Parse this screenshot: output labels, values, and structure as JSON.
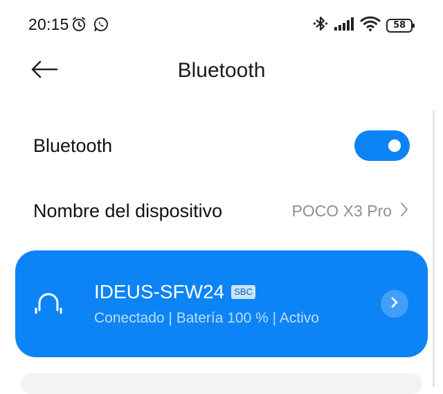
{
  "status_bar": {
    "time": "20:15",
    "battery": "58",
    "icons": [
      "alarm-icon",
      "whatsapp-icon",
      "bluetooth-icon",
      "signal-icon",
      "wifi-icon",
      "battery-icon"
    ]
  },
  "header": {
    "title": "Bluetooth",
    "back_icon": "back-arrow-icon"
  },
  "settings": {
    "bluetooth_label": "Bluetooth",
    "bluetooth_enabled": true,
    "device_name_label": "Nombre del dispositivo",
    "device_name_value": "POCO X3 Pro"
  },
  "device": {
    "name": "IDEUS-SFW24",
    "codec": "SBC",
    "status": "Conectado | Batería 100 % | Activo",
    "icon": "headphones-icon"
  },
  "colors": {
    "accent": "#0d84f5",
    "muted_text": "#8f8f8f"
  }
}
